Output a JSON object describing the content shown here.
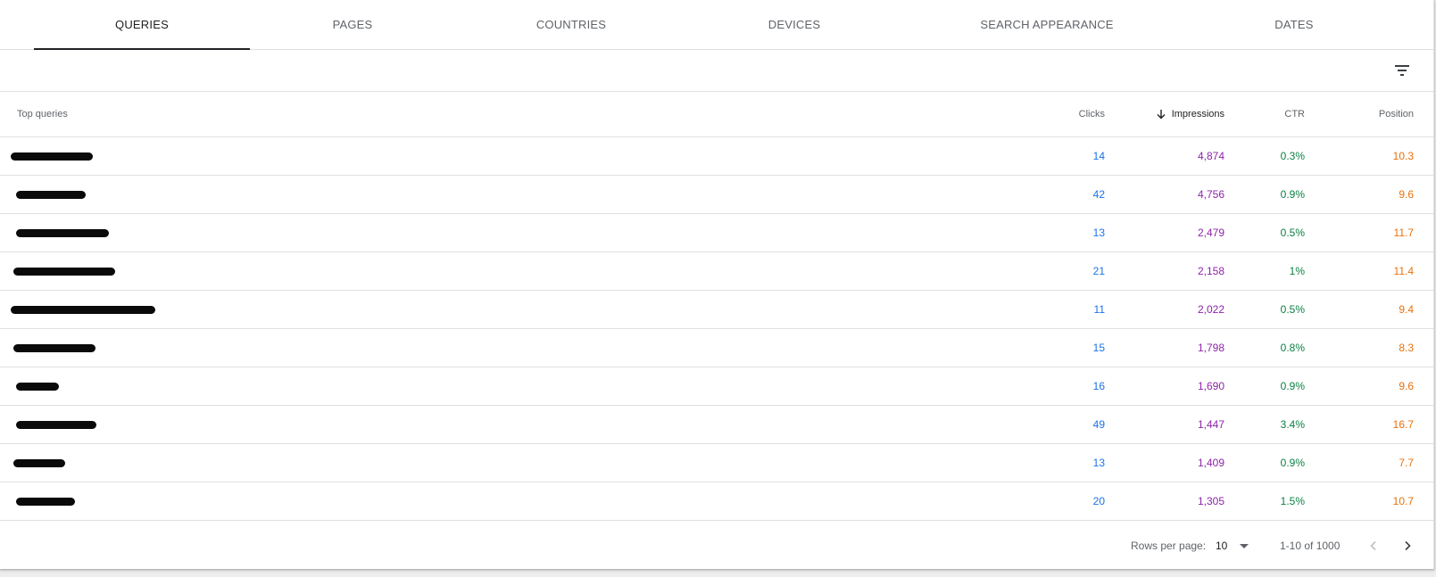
{
  "tabs": [
    {
      "label": "QUERIES"
    },
    {
      "label": "PAGES"
    },
    {
      "label": "COUNTRIES"
    },
    {
      "label": "DEVICES"
    },
    {
      "label": "SEARCH APPEARANCE"
    },
    {
      "label": "DATES"
    }
  ],
  "active_tab": "QUERIES",
  "icons": {
    "filter": "filter-list-icon",
    "sort": "arrow-downward-icon",
    "prev": "chevron-left-icon",
    "next": "chevron-right-icon",
    "dropdown": "arrow-drop-down-icon"
  },
  "table": {
    "columns": {
      "query": "Top queries",
      "clicks": "Clicks",
      "impressions": "Impressions",
      "ctr": "CTR",
      "position": "Position"
    },
    "sorted_by": "Impressions",
    "sort_direction": "descending",
    "rows": [
      {
        "query": "",
        "clicks": "14",
        "impressions": "4,874",
        "ctr": "0.3%",
        "position": "10.3"
      },
      {
        "query": "",
        "clicks": "42",
        "impressions": "4,756",
        "ctr": "0.9%",
        "position": "9.6"
      },
      {
        "query": "",
        "clicks": "13",
        "impressions": "2,479",
        "ctr": "0.5%",
        "position": "11.7"
      },
      {
        "query": "",
        "clicks": "21",
        "impressions": "2,158",
        "ctr": "1%",
        "position": "11.4"
      },
      {
        "query": "",
        "clicks": "11",
        "impressions": "2,022",
        "ctr": "0.5%",
        "position": "9.4"
      },
      {
        "query": "",
        "clicks": "15",
        "impressions": "1,798",
        "ctr": "0.8%",
        "position": "8.3"
      },
      {
        "query": "",
        "clicks": "16",
        "impressions": "1,690",
        "ctr": "0.9%",
        "position": "9.6"
      },
      {
        "query": "",
        "clicks": "49",
        "impressions": "1,447",
        "ctr": "3.4%",
        "position": "16.7"
      },
      {
        "query": "",
        "clicks": "13",
        "impressions": "1,409",
        "ctr": "0.9%",
        "position": "7.7"
      },
      {
        "query": "",
        "clicks": "20",
        "impressions": "1,305",
        "ctr": "1.5%",
        "position": "10.7"
      }
    ]
  },
  "footer": {
    "rows_per_page_label": "Rows per page:",
    "rows_per_page_value": "10",
    "range": "1-10 of 1000"
  },
  "colors": {
    "clicks": "#1a73e8",
    "impressions": "#8e24aa",
    "ctr": "#0b8043",
    "position": "#e8710a"
  }
}
